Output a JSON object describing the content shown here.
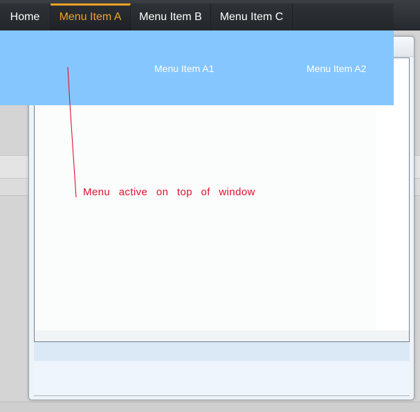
{
  "nav": {
    "items": [
      {
        "label": "Home"
      },
      {
        "label": "Menu Item A"
      },
      {
        "label": "Menu Item B"
      },
      {
        "label": "Menu Item C"
      }
    ],
    "active_index": 1,
    "active_color": "#f2a427"
  },
  "submenu": {
    "background_color": "#86c6fe",
    "items": [
      {
        "label": "Menu Item A1"
      },
      {
        "label": "Menu Item A2"
      }
    ]
  },
  "annotation": {
    "text": "Menu active on top of window",
    "color": "#e0102e"
  }
}
